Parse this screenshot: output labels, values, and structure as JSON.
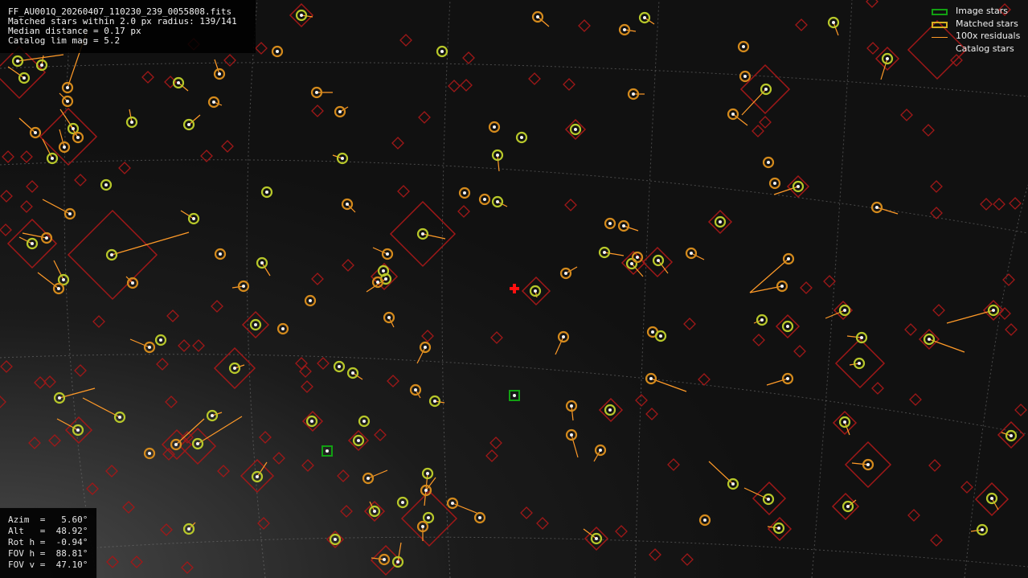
{
  "info": {
    "filename": "FF_AU001Q_20260407_110230_239_0055808.fits",
    "matched": "Matched stars within 2.0 px radius: 139/141",
    "median": "Median distance = 0.17 px",
    "catalog_lim": "Catalog lim mag = 5.2"
  },
  "legend": {
    "image_stars": "Image stars",
    "matched_stars": "Matched stars",
    "residuals": "100x residuals",
    "catalog_stars": "Catalog stars"
  },
  "view": {
    "azim": "Azim  =   5.60°",
    "alt": "Alt   =  48.92°",
    "rot": "Rot h =  -0.94°",
    "fov_h": "FOV h =  88.81°",
    "fov_v": "FOV v =  47.10°"
  },
  "colors": {
    "image_star": "#12a012",
    "matched_star": "#d4b020",
    "residual": "#ff9a28",
    "catalog_star": "#a01818",
    "center_cross": "#ff1010",
    "grid": "#7a7a7a"
  },
  "icons": {
    "center": "red-cross-icon"
  }
}
